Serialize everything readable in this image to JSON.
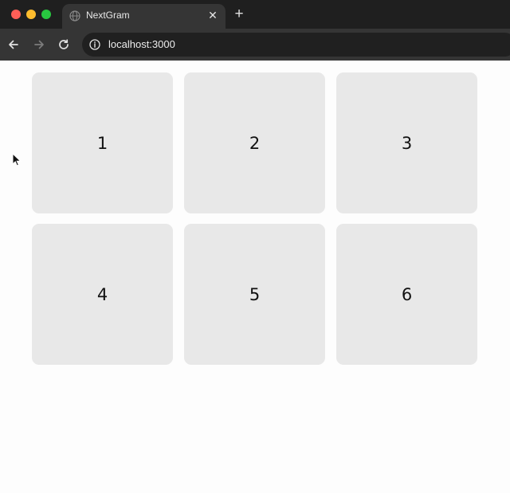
{
  "window": {
    "tab": {
      "title": "NextGram",
      "favicon": "globe-icon",
      "close_icon": "close-icon"
    },
    "new_tab_icon": "plus-icon",
    "traffic_lights": {
      "close_color": "#ff5f57",
      "minimize_color": "#febc2e",
      "maximize_color": "#28c840"
    }
  },
  "toolbar": {
    "back_icon": "arrow-left-icon",
    "forward_icon": "arrow-right-icon",
    "reload_icon": "reload-icon",
    "site_info_icon": "info-icon",
    "url": "localhost:3000"
  },
  "gallery": {
    "cards": [
      {
        "label": "1"
      },
      {
        "label": "2"
      },
      {
        "label": "3"
      },
      {
        "label": "4"
      },
      {
        "label": "5"
      },
      {
        "label": "6"
      }
    ],
    "card_color": "#e8e8e8"
  }
}
